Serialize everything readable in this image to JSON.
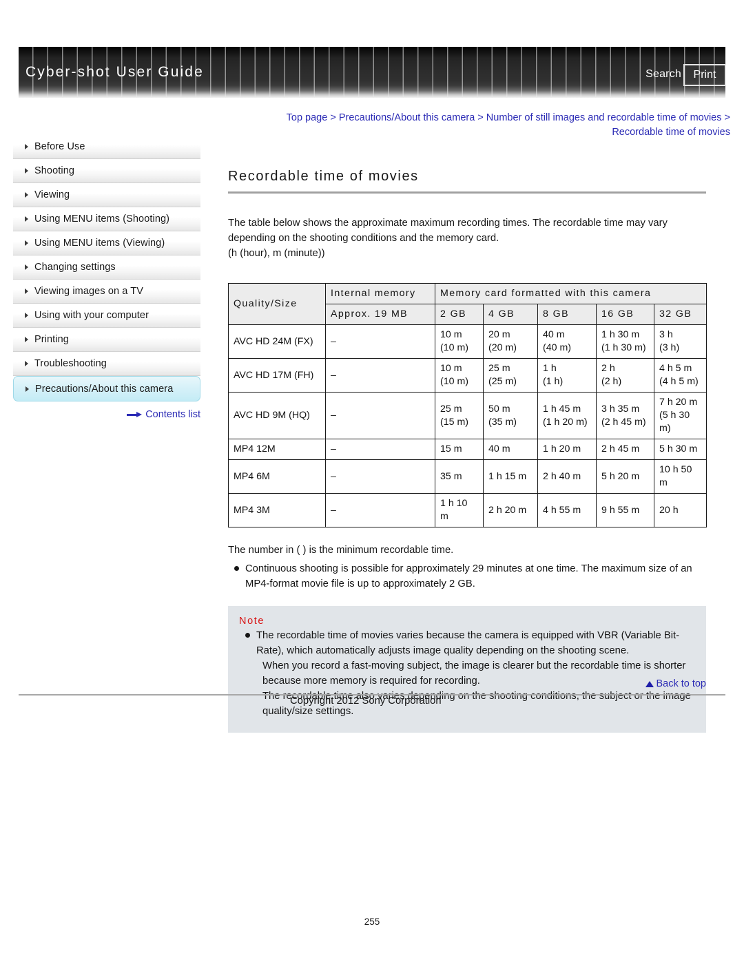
{
  "header": {
    "title": "Cyber-shot User Guide",
    "search_label": "Search",
    "print_label": "Print"
  },
  "breadcrumb": {
    "text": "Top page > Precautions/About this camera > Number of still images and recordable time of movies > Recordable time of movies"
  },
  "sidebar": {
    "items": [
      {
        "label": "Before Use",
        "active": false
      },
      {
        "label": "Shooting",
        "active": false
      },
      {
        "label": "Viewing",
        "active": false
      },
      {
        "label": "Using MENU items (Shooting)",
        "active": false
      },
      {
        "label": "Using MENU items (Viewing)",
        "active": false
      },
      {
        "label": "Changing settings",
        "active": false
      },
      {
        "label": "Viewing images on a TV",
        "active": false
      },
      {
        "label": "Using with your computer",
        "active": false
      },
      {
        "label": "Printing",
        "active": false
      },
      {
        "label": "Troubleshooting",
        "active": false
      },
      {
        "label": "Precautions/About this camera",
        "active": true
      }
    ],
    "contents_list_label": "Contents list"
  },
  "main": {
    "page_title": "Recordable time of movies",
    "intro_line1": "The table below shows the approximate maximum recording times. The recordable time may vary",
    "intro_line2": "depending on the shooting conditions and the memory card.",
    "intro_line3": "(h (hour), m (minute))",
    "after_table_note": "The number in ( ) is the minimum recordable time.",
    "bullet_continuous": "Continuous shooting is possible for approximately 29 minutes at one time. The maximum size of an MP4-format movie file is up to approximately 2 GB."
  },
  "note": {
    "heading": "Note",
    "paragraphs": [
      "The recordable time of movies varies because the camera is equipped with VBR (Variable Bit-Rate), which automatically adjusts image quality depending on the shooting scene.",
      "When you record a fast-moving subject, the image is clearer but the recordable time is shorter because more memory is required for recording.",
      "The recordable time also varies depending on the shooting conditions, the subject or the image quality/size settings."
    ]
  },
  "footer": {
    "back_to_top_label": "Back to top",
    "copyright": "Copyright 2012 Sony Corporation",
    "page_number": "255"
  },
  "chart_data": {
    "type": "table",
    "title": "Recordable time of movies",
    "group_headers": {
      "quality": "Quality/Size",
      "internal": "Internal memory",
      "memory_card": "Memory card formatted with this camera"
    },
    "columns": [
      "Quality/Size",
      "Approx. 19 MB",
      "2 GB",
      "4 GB",
      "8 GB",
      "16 GB",
      "32 GB"
    ],
    "rows": [
      {
        "quality": "AVC HD 24M (FX)",
        "cells": [
          "–",
          "10 m\n(10 m)",
          "20 m\n(20 m)",
          "40 m\n(40 m)",
          "1 h 30 m\n(1 h 30 m)",
          "3 h\n(3 h)"
        ]
      },
      {
        "quality": "AVC HD 17M (FH)",
        "cells": [
          "–",
          "10 m\n(10 m)",
          "25 m\n(25 m)",
          "1 h\n(1 h)",
          "2 h\n(2 h)",
          "4 h 5 m\n(4 h 5 m)"
        ]
      },
      {
        "quality": "AVC HD 9M (HQ)",
        "cells": [
          "–",
          "25 m\n(15 m)",
          "50 m\n(35 m)",
          "1 h 45 m\n(1 h 20 m)",
          "3 h 35 m\n(2 h 45 m)",
          "7 h 20 m\n(5 h 30 m)"
        ]
      },
      {
        "quality": "MP4 12M",
        "cells": [
          "–",
          "15 m",
          "40 m",
          "1 h 20 m",
          "2 h 45 m",
          "5 h 30 m"
        ]
      },
      {
        "quality": "MP4 6M",
        "cells": [
          "–",
          "35 m",
          "1 h 15 m",
          "2 h 40 m",
          "5 h 20 m",
          "10 h 50 m"
        ]
      },
      {
        "quality": "MP4 3M",
        "cells": [
          "–",
          "1 h 10 m",
          "2 h 20 m",
          "4 h 55 m",
          "9 h 55 m",
          "20 h"
        ]
      }
    ]
  },
  "colors": {
    "link": "#2b2bb5",
    "note_heading": "#d81313",
    "note_background": "#e1e5e9",
    "active_sidebar": "#c4ecf6",
    "table_header": "#ececec"
  }
}
